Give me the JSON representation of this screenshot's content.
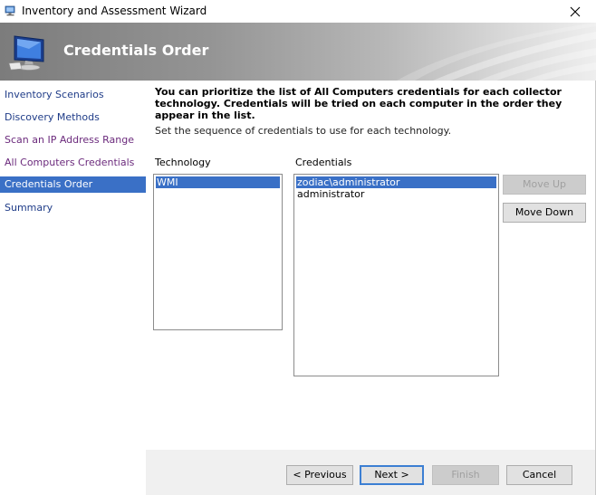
{
  "window": {
    "title": "Inventory and Assessment Wizard"
  },
  "banner": {
    "title": "Credentials Order",
    "icon": "computer-monitor-icon"
  },
  "nav": {
    "items": [
      {
        "label": "Inventory Scenarios",
        "state": "normal"
      },
      {
        "label": "Discovery Methods",
        "state": "normal"
      },
      {
        "label": "Scan an IP Address Range",
        "state": "visited"
      },
      {
        "label": "All Computers Credentials",
        "state": "visited"
      },
      {
        "label": "Credentials Order",
        "state": "active"
      },
      {
        "label": "Summary",
        "state": "normal"
      }
    ]
  },
  "content": {
    "intro": "You can prioritize the list of All Computers credentials for each collector technology. Credentials will be tried on each computer in the order they appear in the list.",
    "subintro": "Set the sequence of credentials to use for each technology.",
    "technology_label": "Technology",
    "credentials_label": "Credentials",
    "technology_items": [
      "WMI"
    ],
    "credentials_items": [
      "zodiac\\administrator",
      "administrator"
    ],
    "move_up_label": "Move Up",
    "move_down_label": "Move Down"
  },
  "footer": {
    "previous_label": "< Previous",
    "next_label": "Next >",
    "finish_label": "Finish",
    "cancel_label": "Cancel"
  },
  "colors": {
    "selection": "#3a70c6",
    "nav_link": "#1f3c88",
    "nav_visited": "#6b2a7c"
  }
}
